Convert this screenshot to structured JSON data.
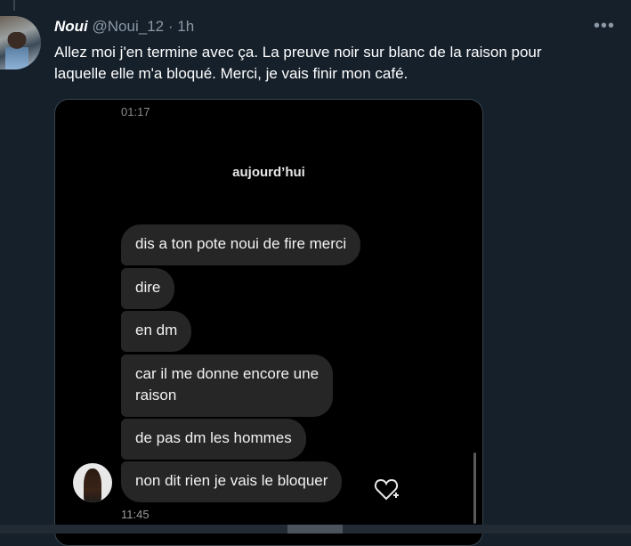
{
  "tweet": {
    "author_name": "Noui",
    "handle": "@Noui_12",
    "separator": "·",
    "time": "1h",
    "more_icon": "more-horizontal-icon",
    "text_lines": [
      "Allez moi j'en termine avec ça. La preuve noir sur blanc de la raison pour",
      "laquelle elle m'a bloqué. Merci, je vais finir mon café."
    ]
  },
  "screenshot": {
    "status_time": "01:17",
    "day_label": "aujourd’hui",
    "messages": [
      [
        "dis a ton pote noui de fire merci"
      ],
      [
        "dire"
      ],
      [
        "en dm"
      ],
      [
        "car il me donne encore une",
        "raison"
      ],
      [
        "de pas dm les hommes"
      ],
      [
        "non dit rien je vais le bloquer"
      ]
    ],
    "message_time": "11:45",
    "like_icon": "heart-plus-icon"
  },
  "colors": {
    "background": "#15202b",
    "bubble": "#262626",
    "muted_text": "#8b98a5"
  }
}
